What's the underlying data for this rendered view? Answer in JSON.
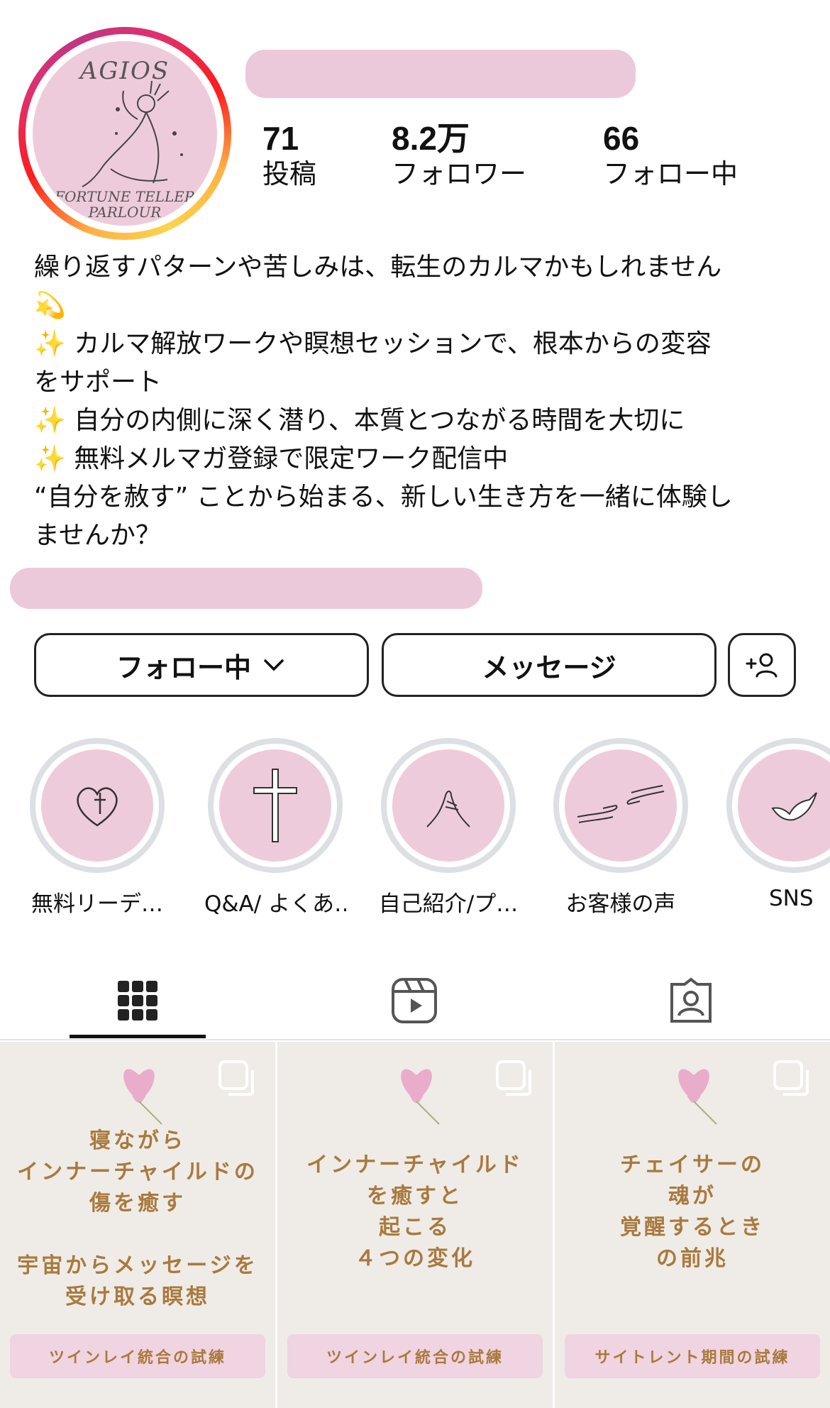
{
  "profile": {
    "avatar_text_top": "AGIOS",
    "avatar_text_bottom": "FORTUNE TELLER PARLOUR",
    "stats": [
      {
        "number": "71",
        "label": "投稿"
      },
      {
        "number": "8.2万",
        "label": "フォロワー"
      },
      {
        "number": "66",
        "label": "フォロー中"
      }
    ],
    "bio": "繰り返すパターンや苦しみは、転生のカルマかもしれません\n💫\n✨ カルマ解放ワークや瞑想セッションで、根本からの変容\nをサポート\n✨ 自分の内側に深く潜り、本質とつながる時間を大切に\n✨ 無料メルマガ登録で限定ワーク配信中\n“自分を赦す” ことから始まる、新しい生き方を一緒に体験し\nませんか？"
  },
  "buttons": {
    "following": "フォロー中",
    "message": "メッセージ"
  },
  "highlights": [
    {
      "label": "無料リーデ…",
      "icon": "heart-cross-icon"
    },
    {
      "label": "Q&A/ よくあ…",
      "icon": "cross-icon"
    },
    {
      "label": "自己紹介/プ…",
      "icon": "praying-hands-icon"
    },
    {
      "label": "お客様の声",
      "icon": "reaching-hands-icon"
    },
    {
      "label": "SNS",
      "icon": "dove-icon"
    }
  ],
  "tabs": [
    "grid-icon",
    "reels-icon",
    "tagged-icon"
  ],
  "posts": [
    {
      "text": "寝ながら\nインナーチャイルドの\n傷を癒す\n\n宇宙からメッセージを\n受け取る瞑想",
      "ribbon": "ツインレイ統合の試練"
    },
    {
      "text": "インナーチャイルド\nを癒すと\n起こる\n４つの変化",
      "ribbon": "ツインレイ統合の試練"
    },
    {
      "text": "チェイサーの\n魂が\n覚醒するとき\nの前兆",
      "ribbon": "サイトレント期間の試練"
    }
  ],
  "colors": {
    "accent_pink": "#eecbdb",
    "post_text": "#a97a3e",
    "post_bg": "#efece8"
  }
}
